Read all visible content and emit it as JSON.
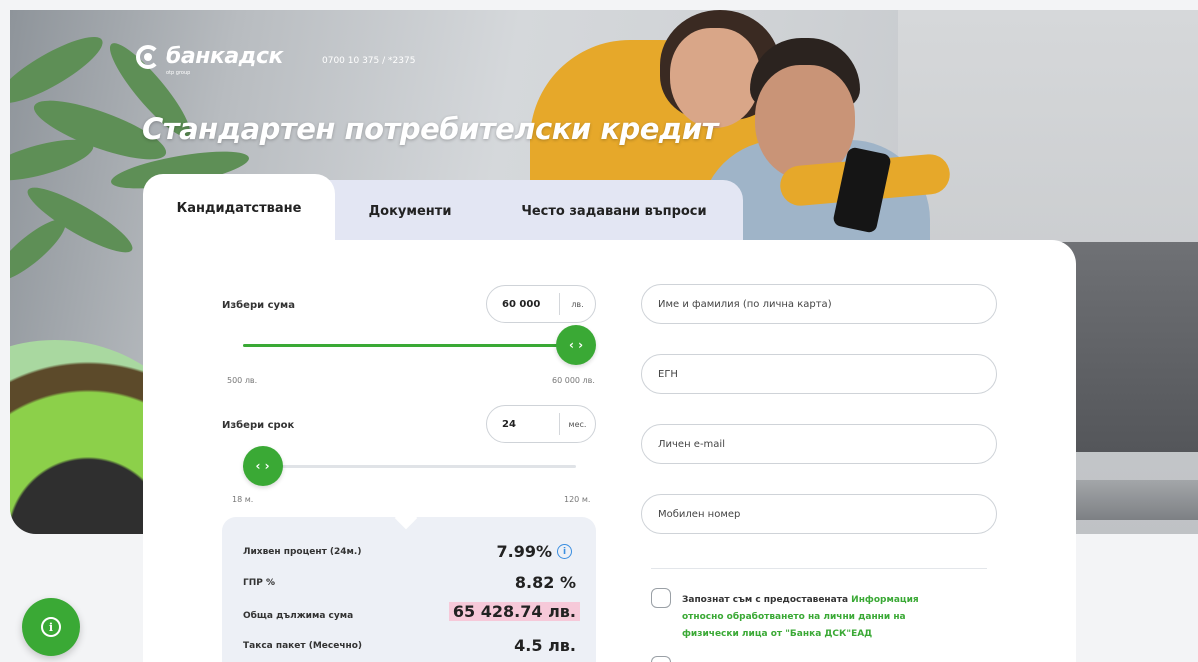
{
  "header": {
    "brand": "банкадск",
    "brand_sub": "otp group",
    "phone": "0700 10 375 / *2375",
    "title": "Стандартен потребителски кредит"
  },
  "tabs": [
    {
      "label": "Кандидатстване",
      "active": true
    },
    {
      "label": "Документи",
      "active": false
    },
    {
      "label": "Често задавани въпроси",
      "active": false
    }
  ],
  "amount": {
    "label": "Избери сума",
    "value": "60 000",
    "unit": "лв.",
    "min_label": "500 лв.",
    "max_label": "60 000 лв.",
    "min": 500,
    "max": 60000,
    "current": 60000
  },
  "term": {
    "label": "Избери срок",
    "value": "24",
    "unit": "мес.",
    "min_label": "18 м.",
    "max_label": "120 м.",
    "min": 18,
    "max": 120,
    "current": 24
  },
  "summary": {
    "rate_label": "Лихвен процент (24м.)",
    "rate_value": "7.99%",
    "apr_label": "ГПР %",
    "apr_value": "8.82 %",
    "total_label": "Обща дължима сума",
    "total_value": "65 428.74 лв.",
    "fee_label": "Такса пакет (Месечно)",
    "fee_value": "4.5 лв."
  },
  "form": {
    "name_placeholder": "Име и фамилия (по лична карта)",
    "egn_placeholder": "ЕГН",
    "email_placeholder": "Личен e-mail",
    "mobile_placeholder": "Мобилен номер",
    "consent_text": "Запознат съм с предоставената ",
    "consent_link": "Информация относно обработването на лични данни на физически лица от \"Банка ДСК\"ЕАД"
  },
  "icons": {
    "knob_glyph": "‹ ›",
    "info_glyph": "i"
  },
  "colors": {
    "accent": "#3aa935",
    "highlight": "#f6c9d9",
    "tab_inactive": "#e3e6f3"
  }
}
